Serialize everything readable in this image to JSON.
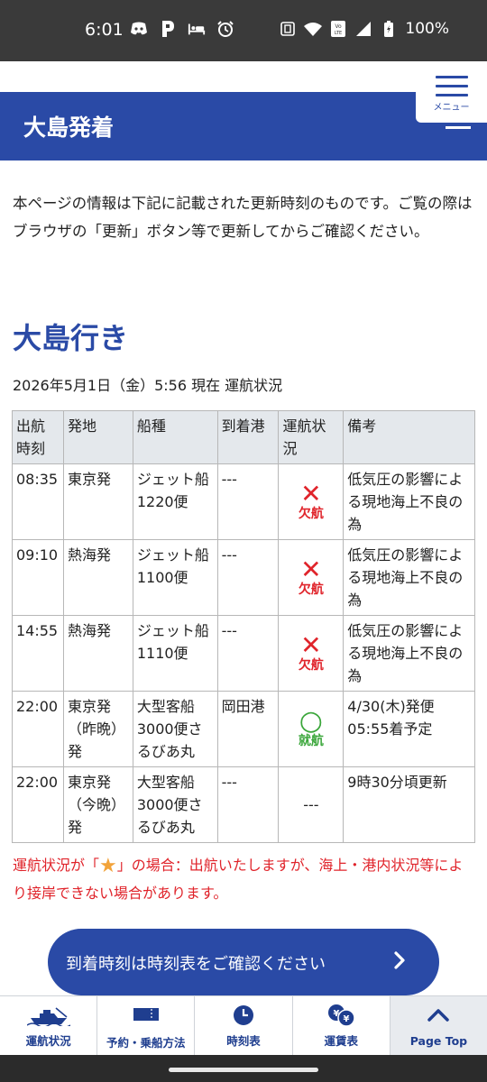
{
  "status_bar": {
    "time": "6:01",
    "battery": "100%",
    "left_icons": [
      "discord-icon",
      "parking-icon",
      "bed-icon",
      "alarm-icon"
    ],
    "right_icons": [
      "nfc-icon",
      "wifi-icon",
      "volte-icon",
      "signal-icon",
      "battery-icon"
    ]
  },
  "header": {
    "title": "大島発着",
    "menu_label": "メニュー",
    "colors": {
      "primary": "#2a4aa6"
    }
  },
  "intro": {
    "text": "本ページの情報は下記に記載された更新時刻のものです。ご覧の際はブラウザの「更新」ボタン等で更新してからご確認ください。"
  },
  "section": {
    "title": "大島行き",
    "status_line": "2026年5月1日（金）5:56 現在 運航状況"
  },
  "table": {
    "headers": [
      "出航時刻",
      "発地",
      "船種",
      "到着港",
      "運航状況",
      "備考"
    ],
    "rows": [
      {
        "time": "08:35",
        "origin": "東京発",
        "ship": "ジェット船 1220便",
        "port": "---",
        "status": "欠航",
        "status_type": "cancel",
        "note": "低気圧の影響による現地海上不良の為"
      },
      {
        "time": "09:10",
        "origin": "熱海発",
        "ship": "ジェット船 1100便",
        "port": "---",
        "status": "欠航",
        "status_type": "cancel",
        "note": "低気圧の影響による現地海上不良の為"
      },
      {
        "time": "14:55",
        "origin": "熱海発",
        "ship": "ジェット船 1110便",
        "port": "---",
        "status": "欠航",
        "status_type": "cancel",
        "note": "低気圧の影響による現地海上不良の為"
      },
      {
        "time": "22:00",
        "origin": "東京発（昨晩）発",
        "ship": "大型客船 3000便さるびあ丸",
        "port": "岡田港",
        "status": "就航",
        "status_type": "operate",
        "note": "4/30(木)発便 05:55着予定"
      },
      {
        "time": "22:00",
        "origin": "東京発（今晩）発",
        "ship": "大型客船 3000便さるびあ丸",
        "port": "---",
        "status": "---",
        "status_type": "none",
        "note": "9時30分頃更新"
      }
    ]
  },
  "notice": {
    "prefix": "運航状況が「",
    "suffix": "」の場合：出航いたしますが、海上・港内状況等により接岸できない場合があります。"
  },
  "cta": {
    "label": "到着時刻は時刻表をご確認ください"
  },
  "bottom_nav": {
    "items": [
      {
        "label": "運航状況",
        "icon": "ship-icon"
      },
      {
        "label": "予約・乗船方法",
        "icon": "ticket-icon"
      },
      {
        "label": "時刻表",
        "icon": "clock-icon"
      },
      {
        "label": "運賃表",
        "icon": "yen-coins-icon"
      },
      {
        "label": "Page Top",
        "icon": "chevron-up-icon"
      }
    ]
  }
}
